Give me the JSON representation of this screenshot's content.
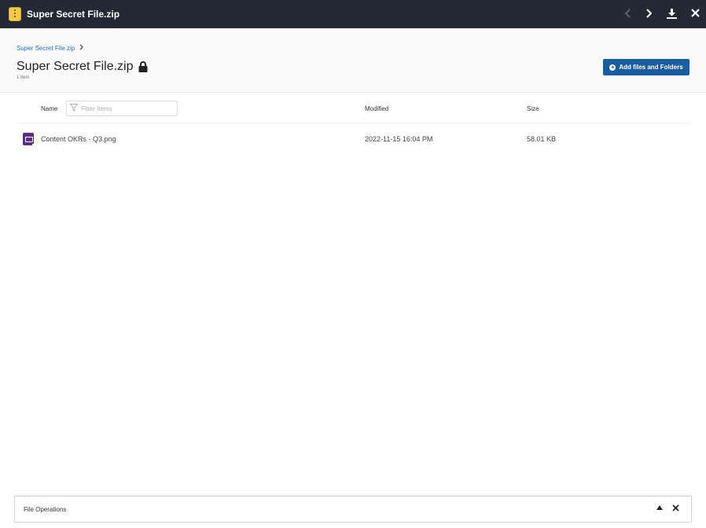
{
  "titlebar": {
    "title": "Super Secret File.zip",
    "icons": [
      "zip-file-icon",
      "chevron-left-icon",
      "chevron-right-icon",
      "download-icon",
      "close-icon"
    ]
  },
  "header": {
    "breadcrumb": "Super Secret File.zip",
    "title": "Super Secret File.zip",
    "item_count": "1 item",
    "add_button_label": "Add files and Folders"
  },
  "table": {
    "columns": {
      "name": "Name",
      "modified": "Modified",
      "size": "Size"
    },
    "filter_placeholder": "Filter Items",
    "rows": [
      {
        "name": "Content OKRs - Q3.png",
        "modified": "2022-11-15 16:04 PM",
        "size": "58.01 KB"
      }
    ]
  },
  "file_operations": {
    "title": "File Operations"
  },
  "colors": {
    "titlebar": "#232a36",
    "accent": "#1a5d9c",
    "image_icon": "#5c2d82"
  }
}
